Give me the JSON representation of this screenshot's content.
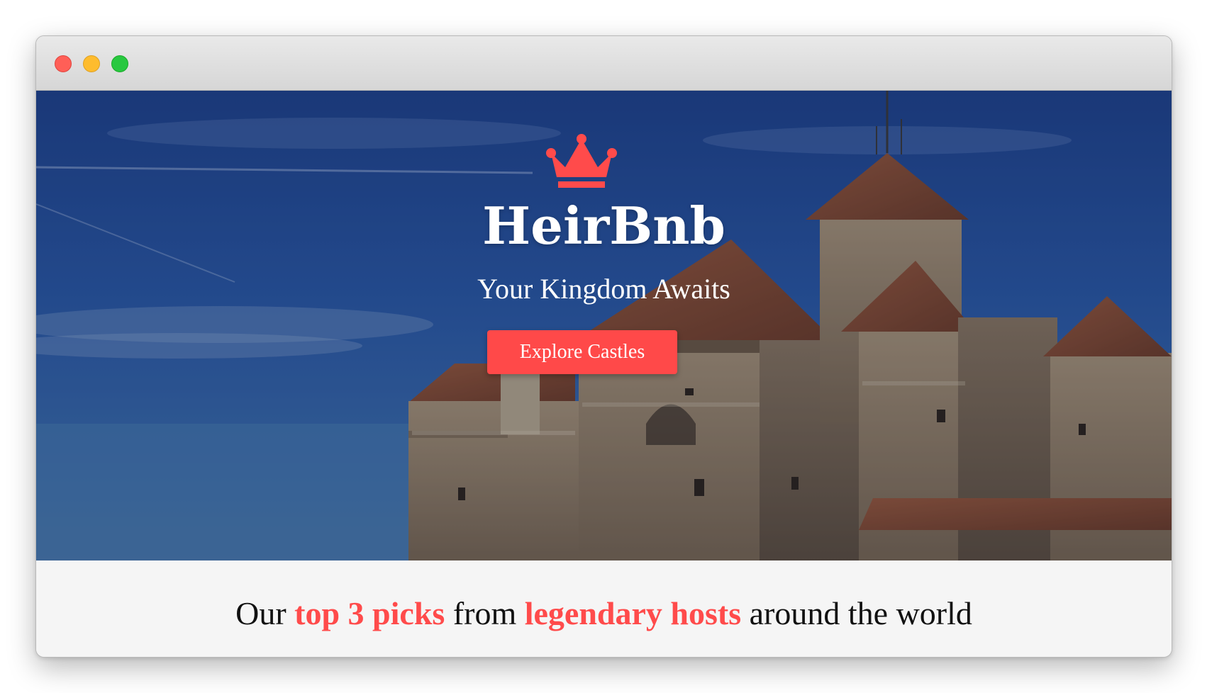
{
  "window": {
    "controls": [
      "close",
      "minimize",
      "maximize"
    ]
  },
  "hero": {
    "logo_icon": "crown-icon",
    "brand": "HeirBnb",
    "tagline": "Your Kingdom Awaits",
    "cta_label": "Explore Castles",
    "background": "castle-photo"
  },
  "content": {
    "headline": {
      "part1": "Our ",
      "highlight1": "top 3 picks",
      "part2": " from ",
      "highlight2": "legendary hosts",
      "part3": " around the world"
    }
  },
  "colors": {
    "accent": "#ff4b4b",
    "button": "#ff4949",
    "page_bg": "#f5f5f5",
    "text": "#111111"
  }
}
